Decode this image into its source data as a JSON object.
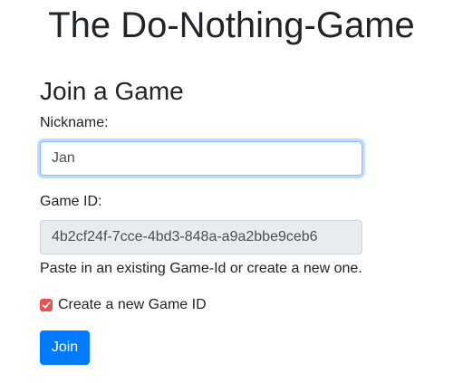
{
  "page": {
    "title": "The Do-Nothing-Game"
  },
  "join_form": {
    "heading": "Join a Game",
    "nickname": {
      "label": "Nickname:",
      "value": "Jan"
    },
    "game_id": {
      "label": "Game ID:",
      "value": "4b2cf24f-7cce-4bd3-848a-a9a2bbe9ceb6",
      "readonly": true
    },
    "help_text": "Paste in an existing Game-Id or create a new one.",
    "create_new": {
      "label": "Create a new Game ID",
      "checked": true
    },
    "submit_label": "Join"
  },
  "colors": {
    "primary": "#007bff",
    "checkbox": "#e55353",
    "focus_border": "#80bdff",
    "readonly_bg": "#e9ecef"
  }
}
